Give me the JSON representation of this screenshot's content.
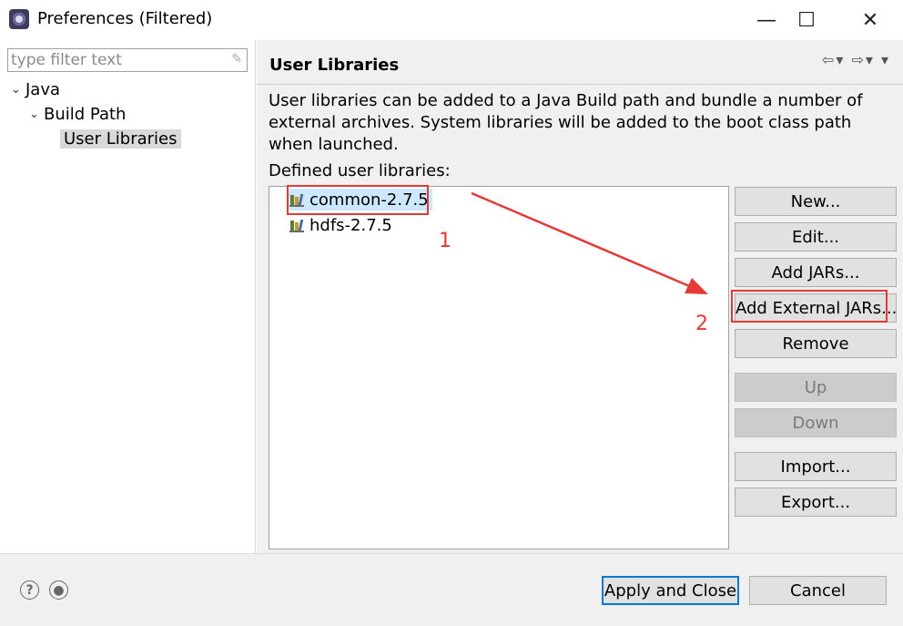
{
  "window": {
    "title": "Preferences (Filtered)",
    "minimize_glyph": "—",
    "maximize_glyph": "☐",
    "close_glyph": "✕"
  },
  "filter": {
    "placeholder": "type filter text"
  },
  "tree": {
    "java": "Java",
    "build_path": "Build Path",
    "user_libraries": "User Libraries"
  },
  "page": {
    "title": "User Libraries",
    "description": "User libraries can be added to a Java Build path and bundle a number of external archives. System libraries will be added to the boot class path when launched.",
    "list_label": "Defined user libraries:"
  },
  "libraries": [
    {
      "name": "common-2.7.5",
      "selected": true
    },
    {
      "name": "hdfs-2.7.5",
      "selected": false
    }
  ],
  "buttons": {
    "new": "New...",
    "edit": "Edit...",
    "add_jars": "Add JARs...",
    "add_external_jars": "Add External JARs...",
    "remove": "Remove",
    "up": "Up",
    "down": "Down",
    "import": "Import...",
    "export": "Export..."
  },
  "annotations": {
    "marker_1": "1",
    "marker_2": "2",
    "color": "#e53935"
  },
  "footer": {
    "apply_close": "Apply and Close",
    "cancel": "Cancel"
  },
  "icons": {
    "app": "eclipse-icon",
    "help": "help-icon",
    "record": "record-icon",
    "back": "back-arrow-icon",
    "forward": "forward-arrow-icon",
    "library": "library-icon"
  }
}
